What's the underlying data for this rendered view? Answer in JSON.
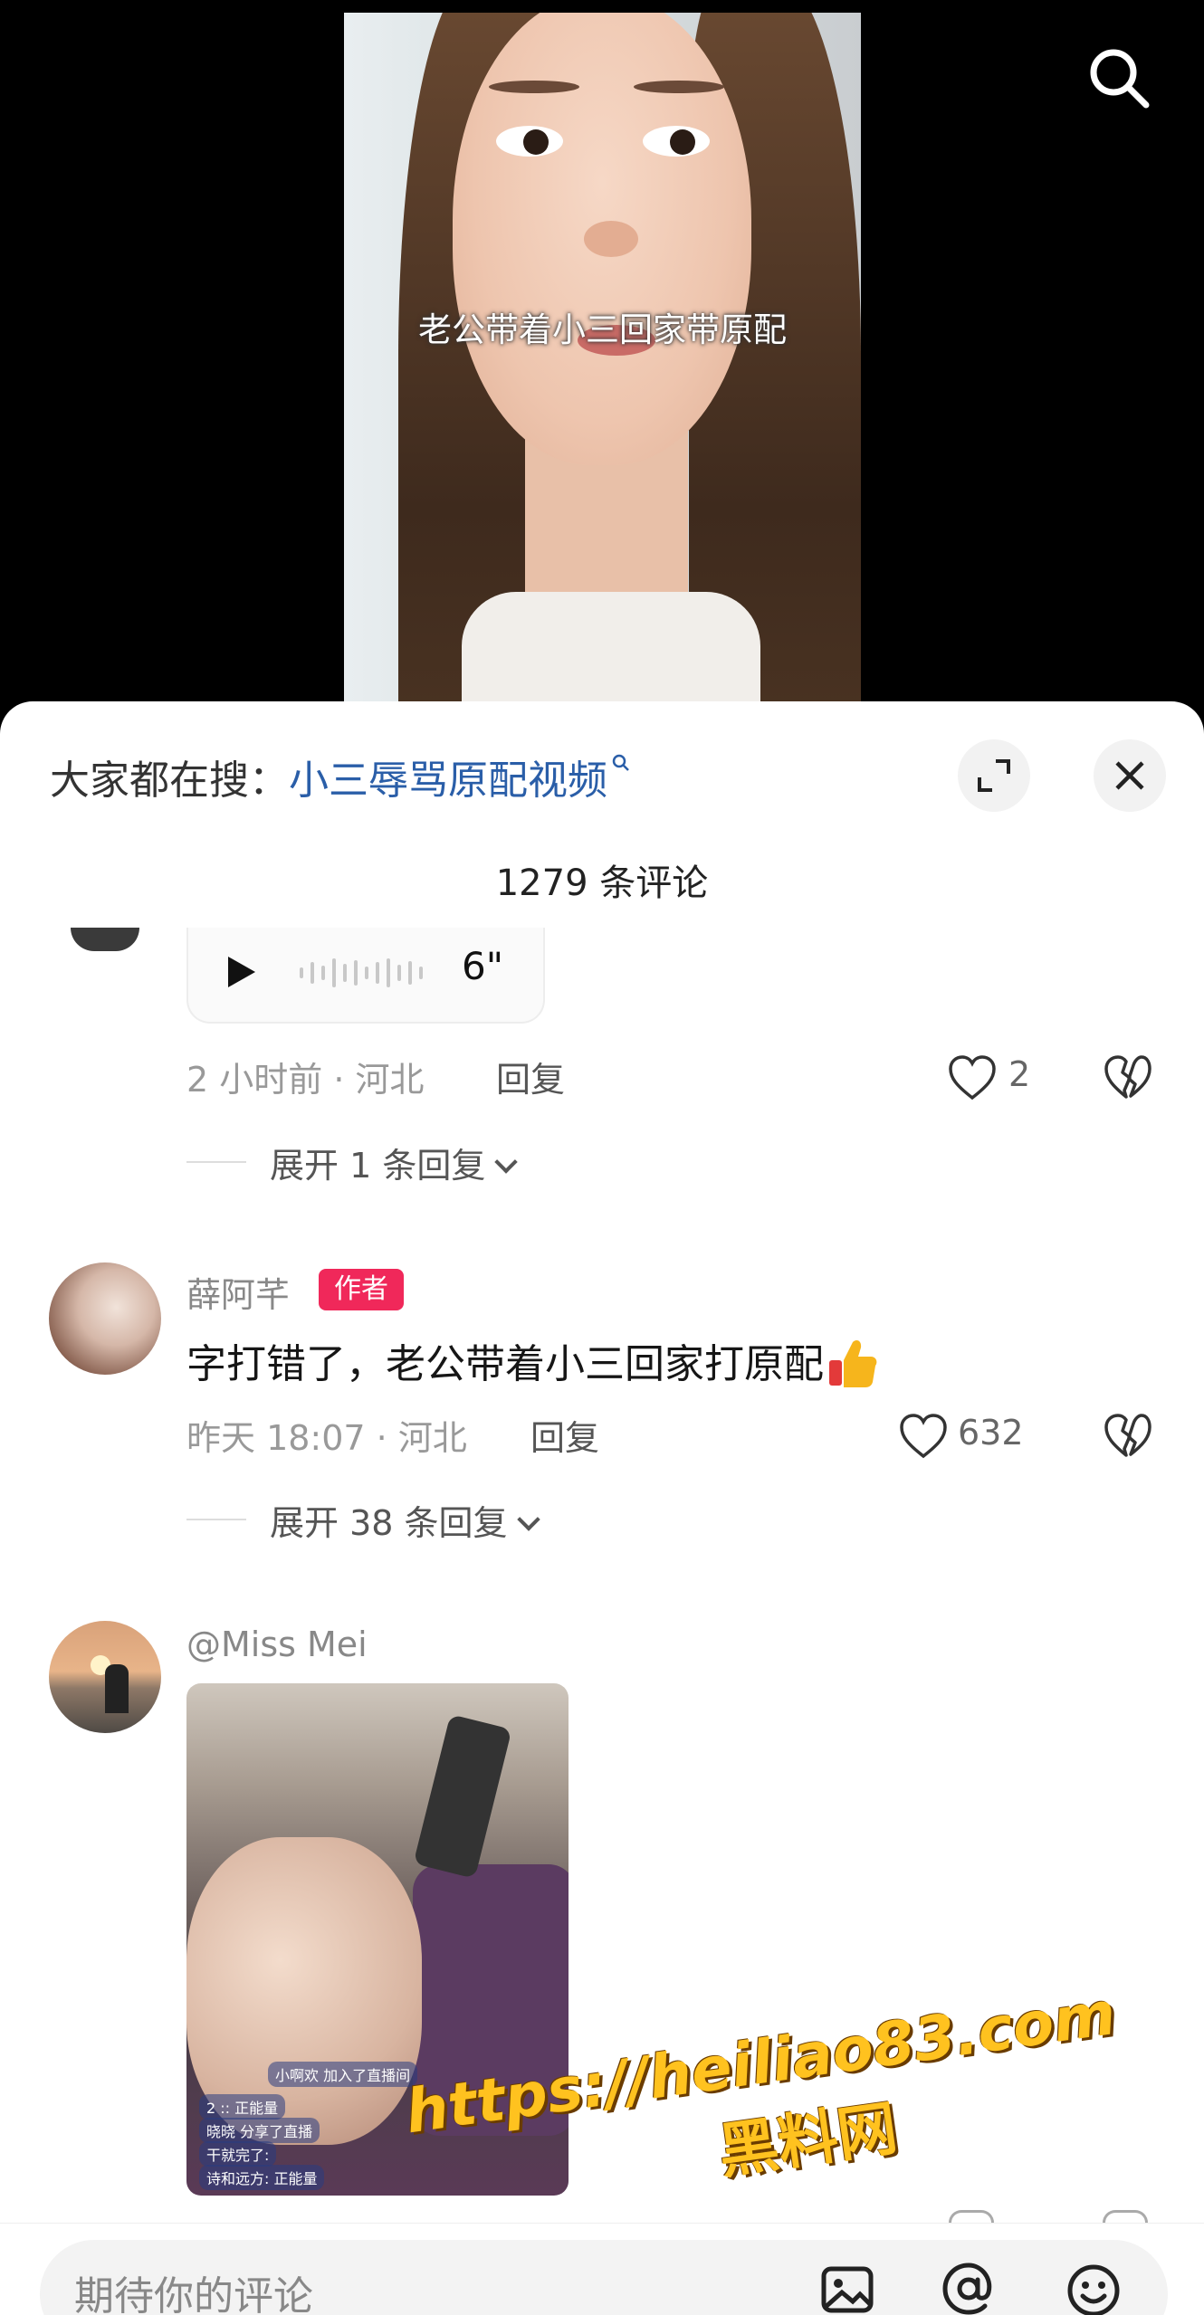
{
  "video": {
    "subtitle": "老公带着小三回家带原配"
  },
  "sheet": {
    "search_prefix": "大家都在搜：",
    "search_keyword": "小三辱骂原配视频",
    "comment_count": "1279 条评论"
  },
  "comments": [
    {
      "voice_duration": "6\"",
      "meta": "2 小时前 · 河北",
      "reply_label": "回复",
      "likes": "2",
      "expand_label": "展开 1 条回复"
    },
    {
      "username": "薛阿芊",
      "badge": "作者",
      "text": "字打错了，老公带着小三回家打原配",
      "meta": "昨天 18:07 · 河北",
      "reply_label": "回复",
      "likes": "632",
      "expand_label": "展开 38 条回复"
    },
    {
      "username": "@Miss Mei",
      "media_lines": [
        "小啊欢 加入了直播间",
        "2 :: 正能量",
        "晓晓 分享了直播",
        "干就完了:",
        "诗和远方: 正能量"
      ]
    }
  ],
  "watermark": {
    "url": "https://heiliao83.com",
    "name": "黑料网"
  },
  "input": {
    "placeholder": "期待你的评论"
  },
  "icons": [
    "search-icon",
    "expand-icon",
    "close-icon",
    "play-icon",
    "heart-icon",
    "broken-heart-icon",
    "thumbs-up-icon",
    "image-icon",
    "at-icon",
    "emoji-icon"
  ]
}
